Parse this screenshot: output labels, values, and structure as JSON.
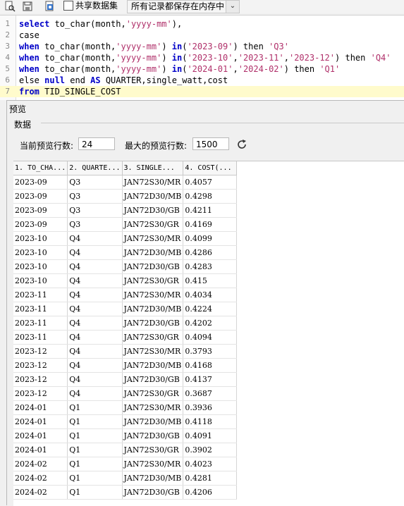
{
  "toolbar": {
    "share_label": "共享数据集",
    "mode_value": "所有记录都保存在内存中"
  },
  "editor": {
    "lines": [
      {
        "n": "1",
        "tokens": [
          {
            "t": "select",
            "k": "kw"
          },
          {
            "t": " to_char(month,",
            "k": "tx"
          },
          {
            "t": "'yyyy-mm'",
            "k": "str"
          },
          {
            "t": "),",
            "k": "tx"
          }
        ]
      },
      {
        "n": "2",
        "tokens": [
          {
            "t": "case",
            "k": "tx"
          }
        ]
      },
      {
        "n": "3",
        "tokens": [
          {
            "t": "when",
            "k": "kw"
          },
          {
            "t": " to_char(month,",
            "k": "tx"
          },
          {
            "t": "'yyyy-mm'",
            "k": "str"
          },
          {
            "t": ") ",
            "k": "tx"
          },
          {
            "t": "in",
            "k": "kw"
          },
          {
            "t": "(",
            "k": "tx"
          },
          {
            "t": "'2023-09'",
            "k": "str"
          },
          {
            "t": ") then ",
            "k": "tx"
          },
          {
            "t": "'Q3'",
            "k": "str"
          }
        ]
      },
      {
        "n": "4",
        "tokens": [
          {
            "t": "when",
            "k": "kw"
          },
          {
            "t": " to_char(month,",
            "k": "tx"
          },
          {
            "t": "'yyyy-mm'",
            "k": "str"
          },
          {
            "t": ") ",
            "k": "tx"
          },
          {
            "t": "in",
            "k": "kw"
          },
          {
            "t": "(",
            "k": "tx"
          },
          {
            "t": "'2023-10'",
            "k": "str"
          },
          {
            "t": ",",
            "k": "tx"
          },
          {
            "t": "'2023-11'",
            "k": "str"
          },
          {
            "t": ",",
            "k": "tx"
          },
          {
            "t": "'2023-12'",
            "k": "str"
          },
          {
            "t": ") then ",
            "k": "tx"
          },
          {
            "t": "'Q4'",
            "k": "str"
          }
        ]
      },
      {
        "n": "5",
        "tokens": [
          {
            "t": "when",
            "k": "kw"
          },
          {
            "t": " to_char(month,",
            "k": "tx"
          },
          {
            "t": "'yyyy-mm'",
            "k": "str"
          },
          {
            "t": ") ",
            "k": "tx"
          },
          {
            "t": "in",
            "k": "kw"
          },
          {
            "t": "(",
            "k": "tx"
          },
          {
            "t": "'2024-01'",
            "k": "str"
          },
          {
            "t": ",",
            "k": "tx"
          },
          {
            "t": "'2024-02'",
            "k": "str"
          },
          {
            "t": ") then ",
            "k": "tx"
          },
          {
            "t": "'Q1'",
            "k": "str"
          }
        ]
      },
      {
        "n": "6",
        "tokens": [
          {
            "t": "else ",
            "k": "tx"
          },
          {
            "t": "null",
            "k": "kw"
          },
          {
            "t": " end ",
            "k": "tx"
          },
          {
            "t": "AS",
            "k": "kw"
          },
          {
            "t": " QUARTER,single_watt,cost",
            "k": "tx"
          }
        ]
      },
      {
        "n": "7",
        "tokens": [
          {
            "t": "from",
            "k": "kw"
          },
          {
            "t": " TID_SINGLE_COST",
            "k": "tx"
          }
        ],
        "highlight": true
      }
    ]
  },
  "preview": {
    "title": "预览",
    "group_label": "数据",
    "current_rows_label": "当前预览行数:",
    "current_rows_value": "24",
    "max_rows_label": "最大的预览行数:",
    "max_rows_value": "1500"
  },
  "grid": {
    "columns": [
      "1. TO_CHA...",
      "2. QUARTE...",
      "3. SINGLE...",
      "4. COST(..."
    ],
    "rows": [
      [
        "2023-09",
        "Q3",
        "JAN72S30/MR",
        "0.4057"
      ],
      [
        "2023-09",
        "Q3",
        "JAN72D30/MB",
        "0.4298"
      ],
      [
        "2023-09",
        "Q3",
        "JAN72D30/GB",
        "0.4211"
      ],
      [
        "2023-09",
        "Q3",
        "JAN72S30/GR",
        "0.4169"
      ],
      [
        "2023-10",
        "Q4",
        "JAN72S30/MR",
        "0.4099"
      ],
      [
        "2023-10",
        "Q4",
        "JAN72D30/MB",
        "0.4286"
      ],
      [
        "2023-10",
        "Q4",
        "JAN72D30/GB",
        "0.4283"
      ],
      [
        "2023-10",
        "Q4",
        "JAN72S30/GR",
        "0.415"
      ],
      [
        "2023-11",
        "Q4",
        "JAN72S30/MR",
        "0.4034"
      ],
      [
        "2023-11",
        "Q4",
        "JAN72D30/MB",
        "0.4224"
      ],
      [
        "2023-11",
        "Q4",
        "JAN72D30/GB",
        "0.4202"
      ],
      [
        "2023-11",
        "Q4",
        "JAN72S30/GR",
        "0.4094"
      ],
      [
        "2023-12",
        "Q4",
        "JAN72S30/MR",
        "0.3793"
      ],
      [
        "2023-12",
        "Q4",
        "JAN72D30/MB",
        "0.4168"
      ],
      [
        "2023-12",
        "Q4",
        "JAN72D30/GB",
        "0.4137"
      ],
      [
        "2023-12",
        "Q4",
        "JAN72S30/GR",
        "0.3687"
      ],
      [
        "2024-01",
        "Q1",
        "JAN72S30/MR",
        "0.3936"
      ],
      [
        "2024-01",
        "Q1",
        "JAN72D30/MB",
        "0.4118"
      ],
      [
        "2024-01",
        "Q1",
        "JAN72D30/GB",
        "0.4091"
      ],
      [
        "2024-01",
        "Q1",
        "JAN72S30/GR",
        "0.3902"
      ],
      [
        "2024-02",
        "Q1",
        "JAN72S30/MR",
        "0.4023"
      ],
      [
        "2024-02",
        "Q1",
        "JAN72D30/MB",
        "0.4281"
      ],
      [
        "2024-02",
        "Q1",
        "JAN72D30/GB",
        "0.4206"
      ]
    ]
  },
  "colors": {
    "keyword": "#0000c8",
    "string": "#b0306a",
    "current_line": "#fffbcc"
  }
}
